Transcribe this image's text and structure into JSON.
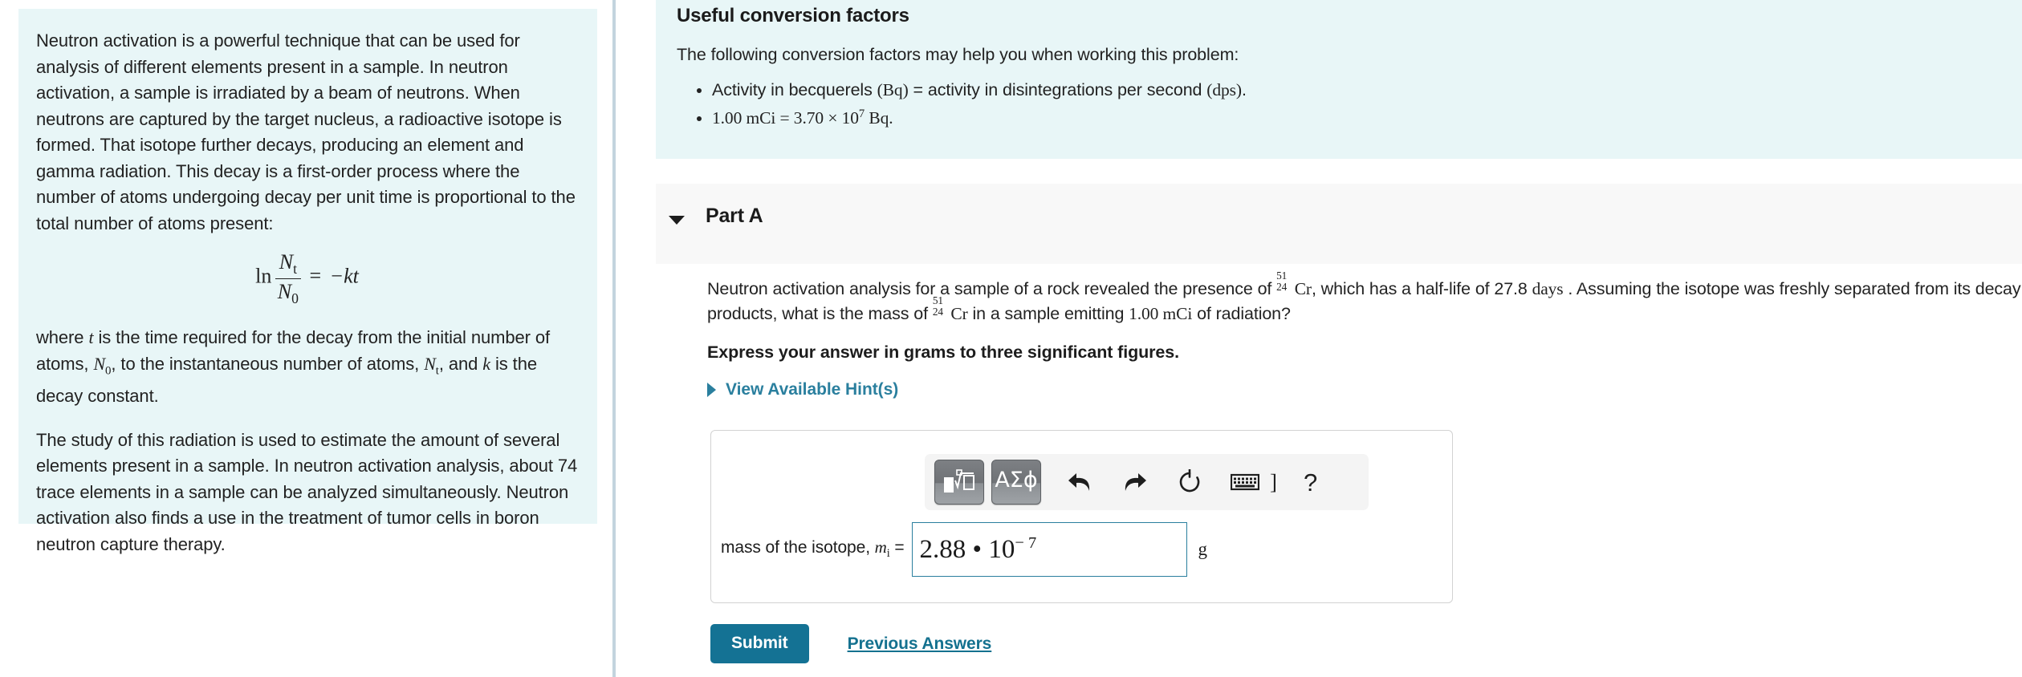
{
  "left_panel": {
    "paragraphs": [
      "Neutron activation is a powerful technique that can be used for analysis of different elements present in a sample. In neutron activation, a sample is irradiated by a beam of neutrons. When neutrons are captured by the target nucleus, a radioactive isotope is formed. That isotope further decays, producing an element and gamma radiation. This decay is a first-order process where the number of atoms undergoing decay per unit time is proportional to the total number of atoms present:",
      "The study of this radiation is used to estimate the amount of several elements present in a sample. In neutron activation analysis, about 74 trace elements in a sample can be analyzed simultaneously. Neutron activation also finds a use in the treatment of tumor cells in boron neutron capture therapy."
    ],
    "equation": {
      "ln": "ln",
      "numerator": "N",
      "numerator_sub": "t",
      "denominator": "N",
      "denominator_sub": "0",
      "equals": "=",
      "rhs": "−kt"
    },
    "where_clause": {
      "p1": "where ",
      "t": "t",
      "p2": " is the time required for the decay from the initial number of atoms, ",
      "n0": "N",
      "n0_sub": "0",
      "p3": ", to the instantaneous number of atoms, ",
      "nt": "N",
      "nt_sub": "t",
      "p4": ", and ",
      "k": "k",
      "p5": " is the decay constant."
    }
  },
  "conversion_box": {
    "title": "Useful conversion factors",
    "lead": "The following conversion factors may help you when working this problem:",
    "items": [
      {
        "pre": "Activity in becquerels ",
        "unit1": "(Bq)",
        "mid": " = activity in disintegrations per second ",
        "unit2": "(dps)",
        "post": "."
      },
      {
        "value": "1.00 mCi = 3.70 × 10",
        "exponent": "7",
        "tail": " Bq."
      }
    ]
  },
  "part_a": {
    "title": "Part A",
    "disclosure_icon": "triangle-down-icon",
    "question": {
      "seg1": "Neutron activation analysis for a sample of a rock revealed the presence of ",
      "nuclide_mass": "51",
      "nuclide_number": "24",
      "nuclide_symbol": "Cr",
      "seg2": ", which has a half-life of 27.8 ",
      "halflife_unit": "days",
      "seg3": " . Assuming the isotope was freshly separated from its decay products, what is the mass of ",
      "seg4": " in a sample emitting ",
      "activity": "1.00 mCi",
      "seg5": " of radiation?"
    },
    "express_answer": "Express your answer in grams to three significant figures.",
    "hints_label": "View Available Hint(s)",
    "hints_caret_icon": "triangle-right-icon"
  },
  "answer_box": {
    "toolbar": {
      "template_button": {
        "icon": "math-template-icon",
        "label": "√"
      },
      "symbols_button": {
        "icon": "greek-symbols-icon",
        "label": "ΑΣϕ"
      },
      "undo": {
        "icon": "undo-arrow-icon"
      },
      "redo": {
        "icon": "redo-arrow-icon"
      },
      "reset": {
        "icon": "reset-circular-arrow-icon"
      },
      "keyboard": {
        "icon": "keyboard-icon"
      },
      "bracket": {
        "icon": "close-bracket-icon",
        "label": "]"
      },
      "help": {
        "icon": "question-mark-icon",
        "label": "?"
      }
    },
    "answer_label_text": "mass of the isotope, ",
    "answer_label_var": "m",
    "answer_label_sub": "i",
    "answer_label_equals": " =",
    "answer_value": {
      "mantissa": "2.88 • 10",
      "exponent": "− 7"
    },
    "unit": "g",
    "placeholder": ""
  },
  "actions": {
    "submit_label": "Submit",
    "previous_answers_label": "Previous Answers"
  },
  "colors": {
    "panel_cyan": "#e8f6f7",
    "accent_teal": "#2a7f9e",
    "submit_blue": "#147294",
    "part_header_grey": "#f8f8f8",
    "divider_blue_grey": "#c3d4de"
  }
}
